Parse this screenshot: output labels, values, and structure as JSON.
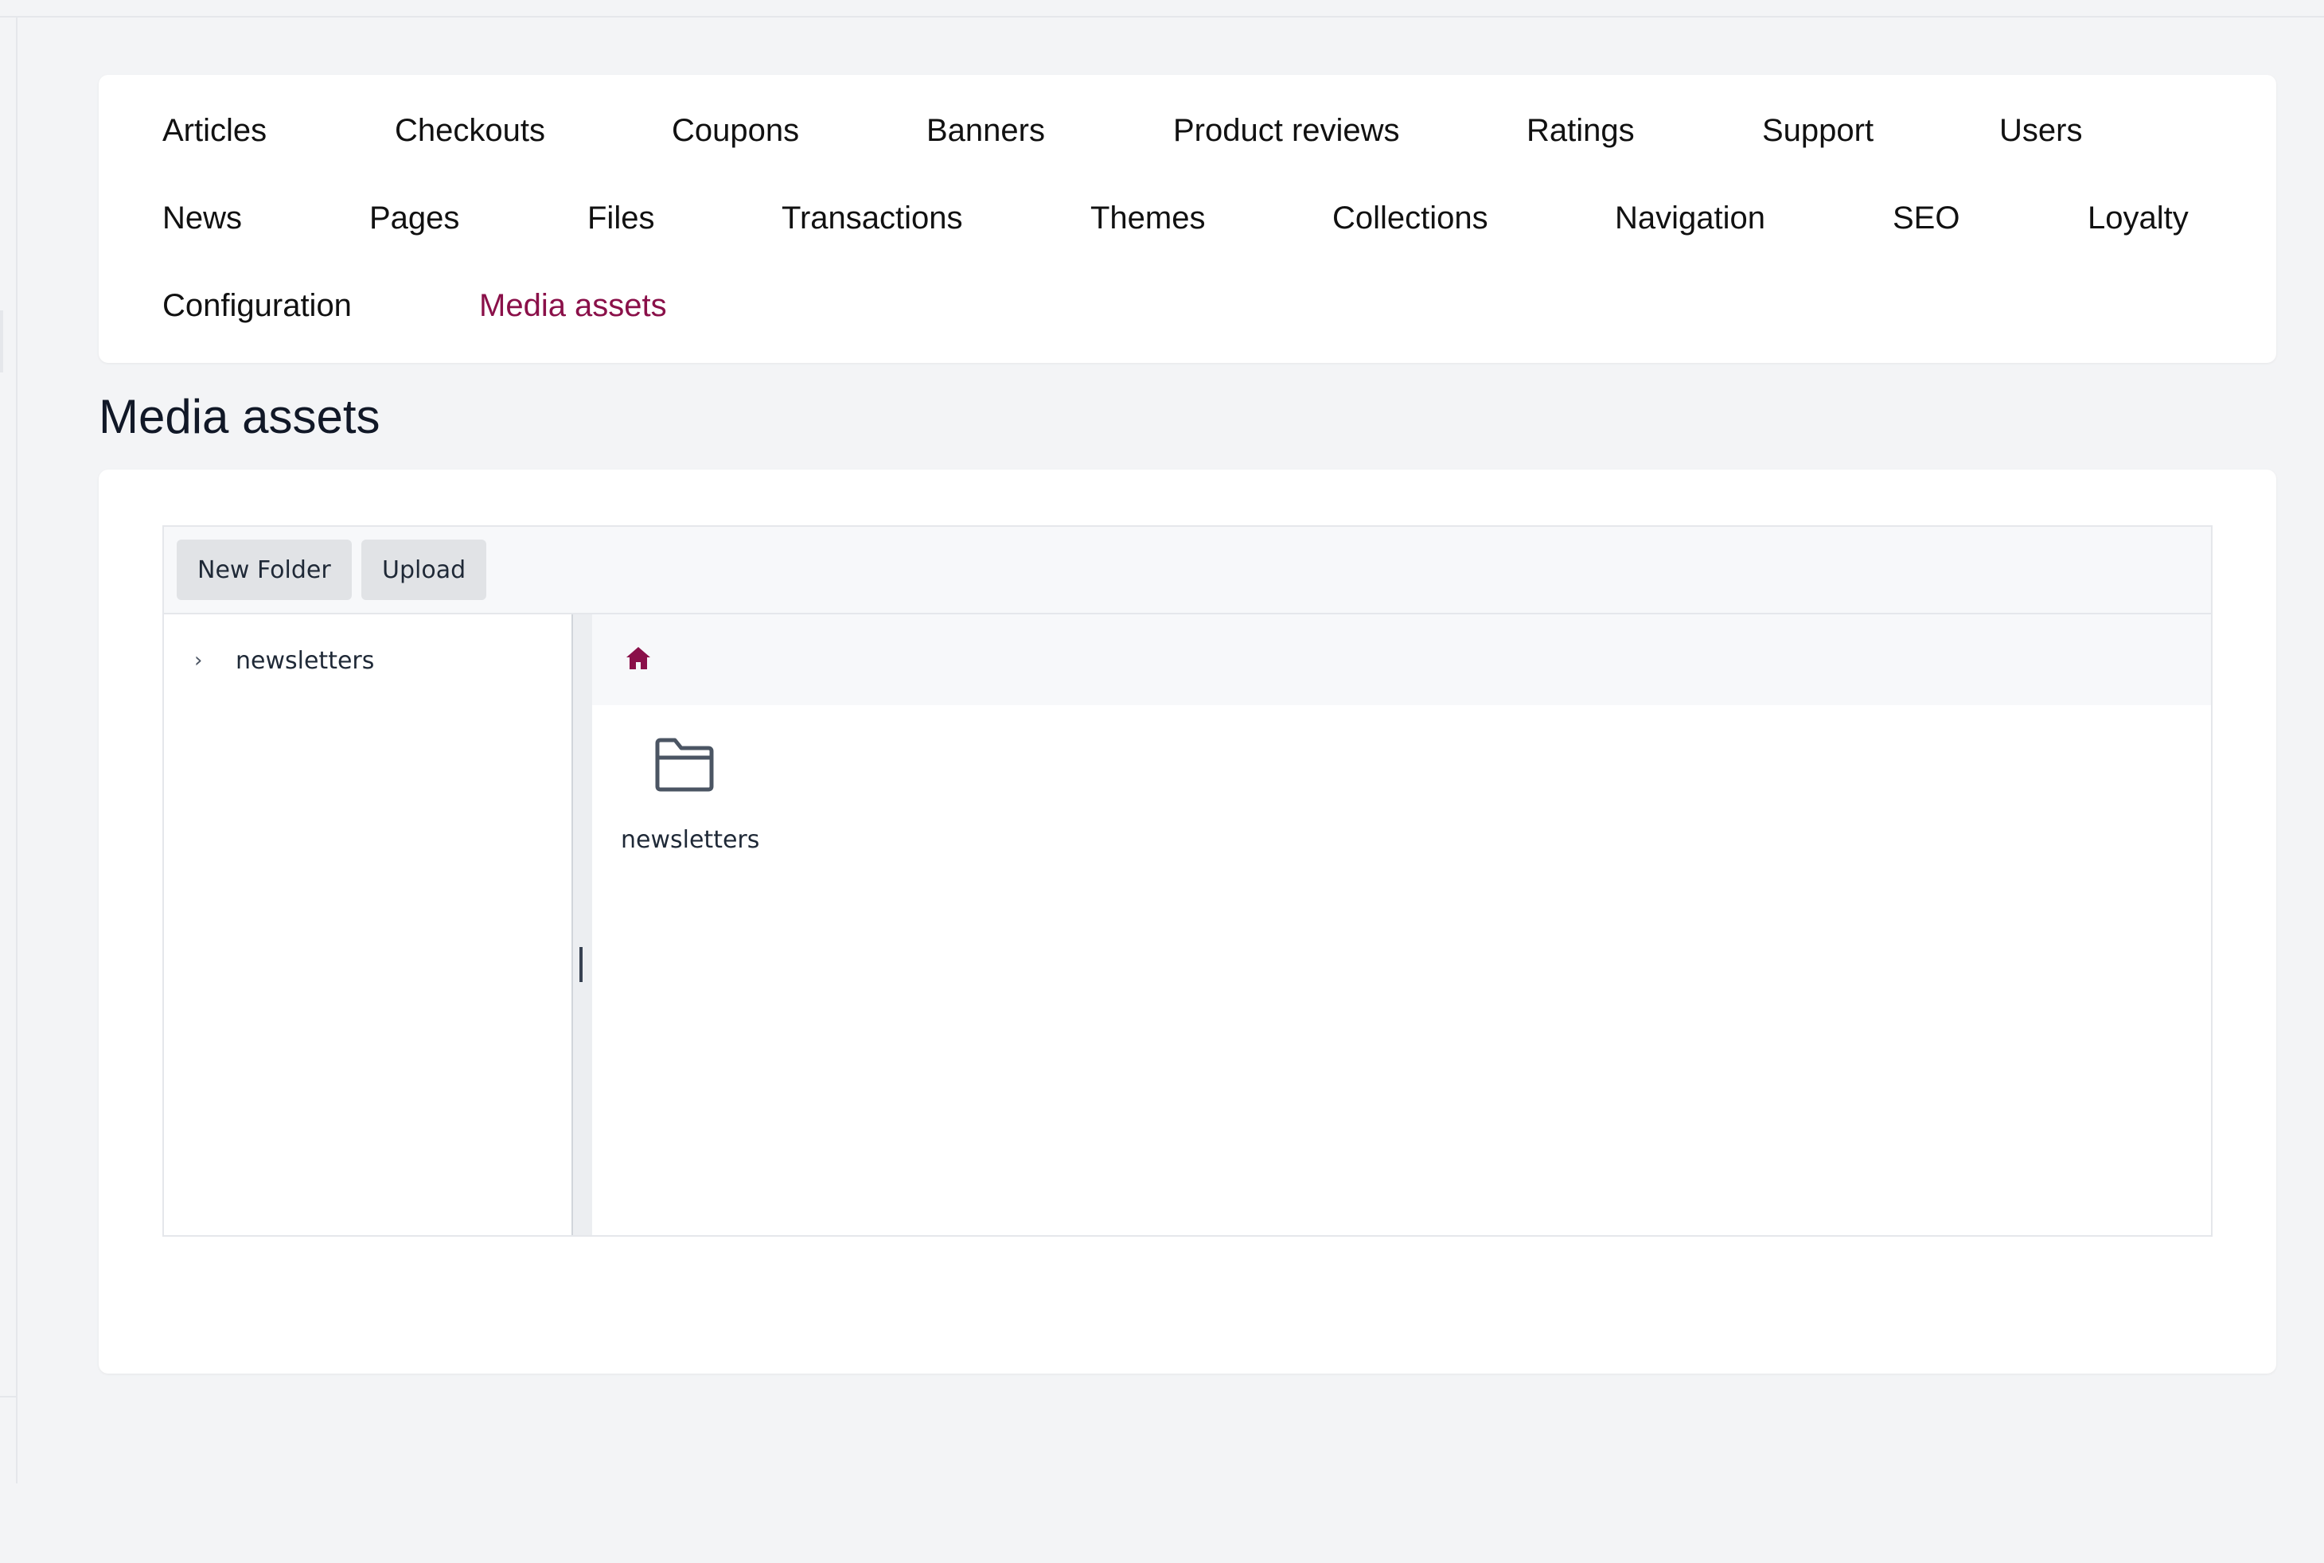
{
  "nav": {
    "links": [
      {
        "label": "Articles"
      },
      {
        "label": "Checkouts"
      },
      {
        "label": "Coupons"
      },
      {
        "label": "Banners"
      },
      {
        "label": "Product reviews"
      },
      {
        "label": "Ratings"
      },
      {
        "label": "Support"
      },
      {
        "label": "Users"
      },
      {
        "label": "News"
      },
      {
        "label": "Pages"
      },
      {
        "label": "Files"
      },
      {
        "label": "Transactions"
      },
      {
        "label": "Themes"
      },
      {
        "label": "Collections"
      },
      {
        "label": "Navigation"
      },
      {
        "label": "SEO"
      },
      {
        "label": "Loyalty"
      },
      {
        "label": "Configuration"
      },
      {
        "label": "Media assets",
        "active": true
      }
    ]
  },
  "page": {
    "title": "Media assets"
  },
  "explorer": {
    "toolbar": {
      "new_folder_label": "New Folder",
      "upload_label": "Upload"
    },
    "tree": {
      "items": [
        {
          "label": "newsletters",
          "chevron": "›"
        }
      ]
    },
    "breadcrumb": {
      "icon": "home-icon"
    },
    "folders": [
      {
        "label": "newsletters",
        "icon": "folder-icon"
      }
    ]
  },
  "colors": {
    "accent": "#8a1049",
    "background": "#f3f4f6",
    "card": "#ffffff"
  }
}
